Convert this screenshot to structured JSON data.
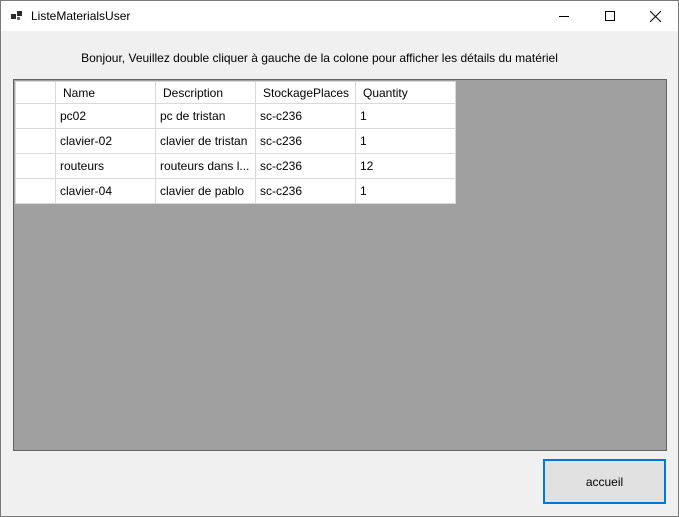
{
  "window": {
    "title": "ListeMaterialsUser",
    "icon": "app-window-icon",
    "controls": {
      "minimize_icon": "minimize-icon",
      "maximize_icon": "maximize-icon",
      "close_icon": "close-icon"
    }
  },
  "instructions": "Bonjour, Veuillez double cliquer à gauche de la colone pour afficher les détails du matériel",
  "grid": {
    "columns": [
      "Name",
      "Description",
      "StockagePlaces",
      "Quantity"
    ],
    "rows": [
      {
        "name": "pc02",
        "description": "pc de tristan",
        "place": "sc-c236",
        "quantity": "1"
      },
      {
        "name": "clavier-02",
        "description": "clavier de tristan",
        "place": "sc-c236",
        "quantity": "1"
      },
      {
        "name": "routeurs",
        "description": "routeurs dans l...",
        "place": "sc-c236",
        "quantity": "12"
      },
      {
        "name": "clavier-04",
        "description": "clavier de pablo",
        "place": "sc-c236",
        "quantity": "1"
      }
    ]
  },
  "buttons": {
    "accueil": "accueil"
  },
  "colors": {
    "grid_background": "#a0a0a0",
    "window_background": "#f0f0f0",
    "focus_border": "#0078d7"
  }
}
